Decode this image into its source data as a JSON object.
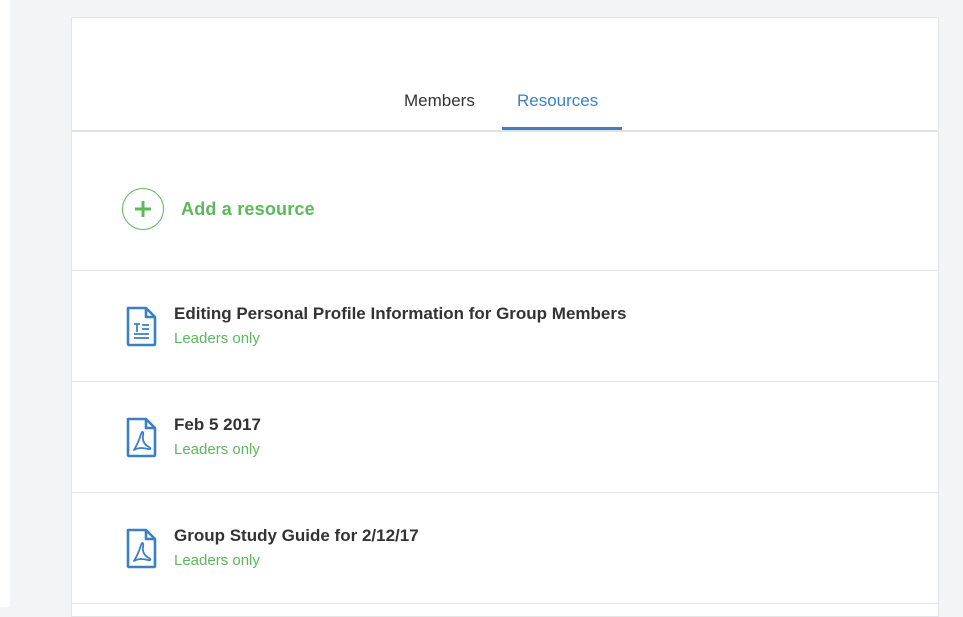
{
  "tabs": [
    {
      "label": "Members",
      "active": false
    },
    {
      "label": "Resources",
      "active": true
    }
  ],
  "add_resource": {
    "label": "Add a resource",
    "icon": "plus-circle-icon"
  },
  "resources": [
    {
      "title": "Editing Personal Profile Information for Group Members",
      "access": "Leaders only",
      "icon": "text-document-icon"
    },
    {
      "title": "Feb 5 2017",
      "access": "Leaders only",
      "icon": "pdf-document-icon"
    },
    {
      "title": "Group Study Guide for 2/12/17",
      "access": "Leaders only",
      "icon": "pdf-document-icon"
    }
  ],
  "colors": {
    "accent_blue": "#3b7fc4",
    "accent_green": "#5cb85c",
    "text_dark": "#333333",
    "border": "#e3e5e8"
  }
}
